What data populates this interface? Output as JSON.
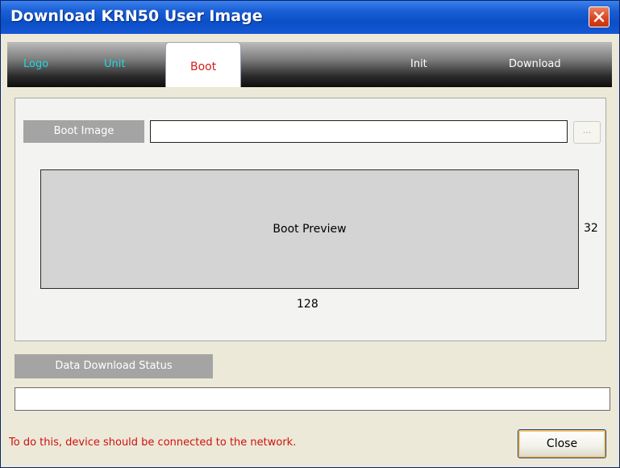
{
  "window": {
    "title": "Download KRN50 User Image"
  },
  "tabs": [
    {
      "label": "Logo",
      "active": false
    },
    {
      "label": "Unit",
      "active": false
    },
    {
      "label": "Boot",
      "active": true
    },
    {
      "label": "Init",
      "active": false
    },
    {
      "label": "Download",
      "active": false
    }
  ],
  "boot": {
    "image_label": "Boot Image",
    "image_value": "",
    "browse_label": "...",
    "preview_label": "Boot Preview",
    "height_value": "32",
    "width_value": "128"
  },
  "status": {
    "label": "Data Download Status",
    "value": ""
  },
  "footer": {
    "warning": "To do this, device should be connected to the network.",
    "close_label": "Close"
  },
  "colors": {
    "titlebar": "#0b4fc7",
    "active_tab_text": "#d61b1b",
    "inactive_tab_text": "#1fd9df",
    "warning_text": "#d01010"
  }
}
